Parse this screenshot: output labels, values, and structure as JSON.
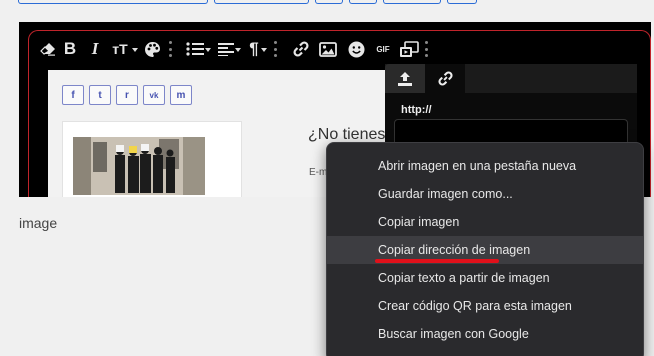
{
  "editor_toolbar": {
    "items": [
      {
        "name": "eraser-icon"
      },
      {
        "name": "bold-icon",
        "glyph": "B"
      },
      {
        "name": "italic-icon",
        "glyph": "I"
      },
      {
        "name": "font-size-icon",
        "glyph": "тT"
      },
      {
        "name": "palette-icon"
      },
      {
        "name": "unordered-list-icon"
      },
      {
        "name": "align-icon"
      },
      {
        "name": "paragraph-icon",
        "glyph": "¶"
      },
      {
        "name": "link-icon"
      },
      {
        "name": "image-icon"
      },
      {
        "name": "emoji-icon"
      },
      {
        "name": "gif-icon",
        "glyph": "GIF"
      },
      {
        "name": "media-icon"
      }
    ]
  },
  "editor_content": {
    "share_buttons": [
      "f",
      "t",
      "r",
      "vk",
      "m"
    ],
    "heading_fragment": "¿No tienes",
    "email_fragment": "E-m"
  },
  "link_panel": {
    "tabs": [
      "upload-icon",
      "link-icon"
    ],
    "url_label": "http://",
    "url_value": ""
  },
  "context_menu": {
    "items": [
      "Abrir imagen en una pestaña nueva",
      "Guardar imagen como...",
      "Copiar imagen",
      "Copiar dirección de imagen",
      "Copiar texto a partir de imagen",
      "Crear código QR para esta imagen",
      "Buscar imagen con Google"
    ],
    "highlighted_index": 3,
    "annotation_color": "#e0101a"
  },
  "page": {
    "caption": "image"
  },
  "colors": {
    "editor_bg": "#000000",
    "editor_border": "#c0242b",
    "menu_bg": "#2a2a2d",
    "page_bg": "#f0f0f0"
  }
}
